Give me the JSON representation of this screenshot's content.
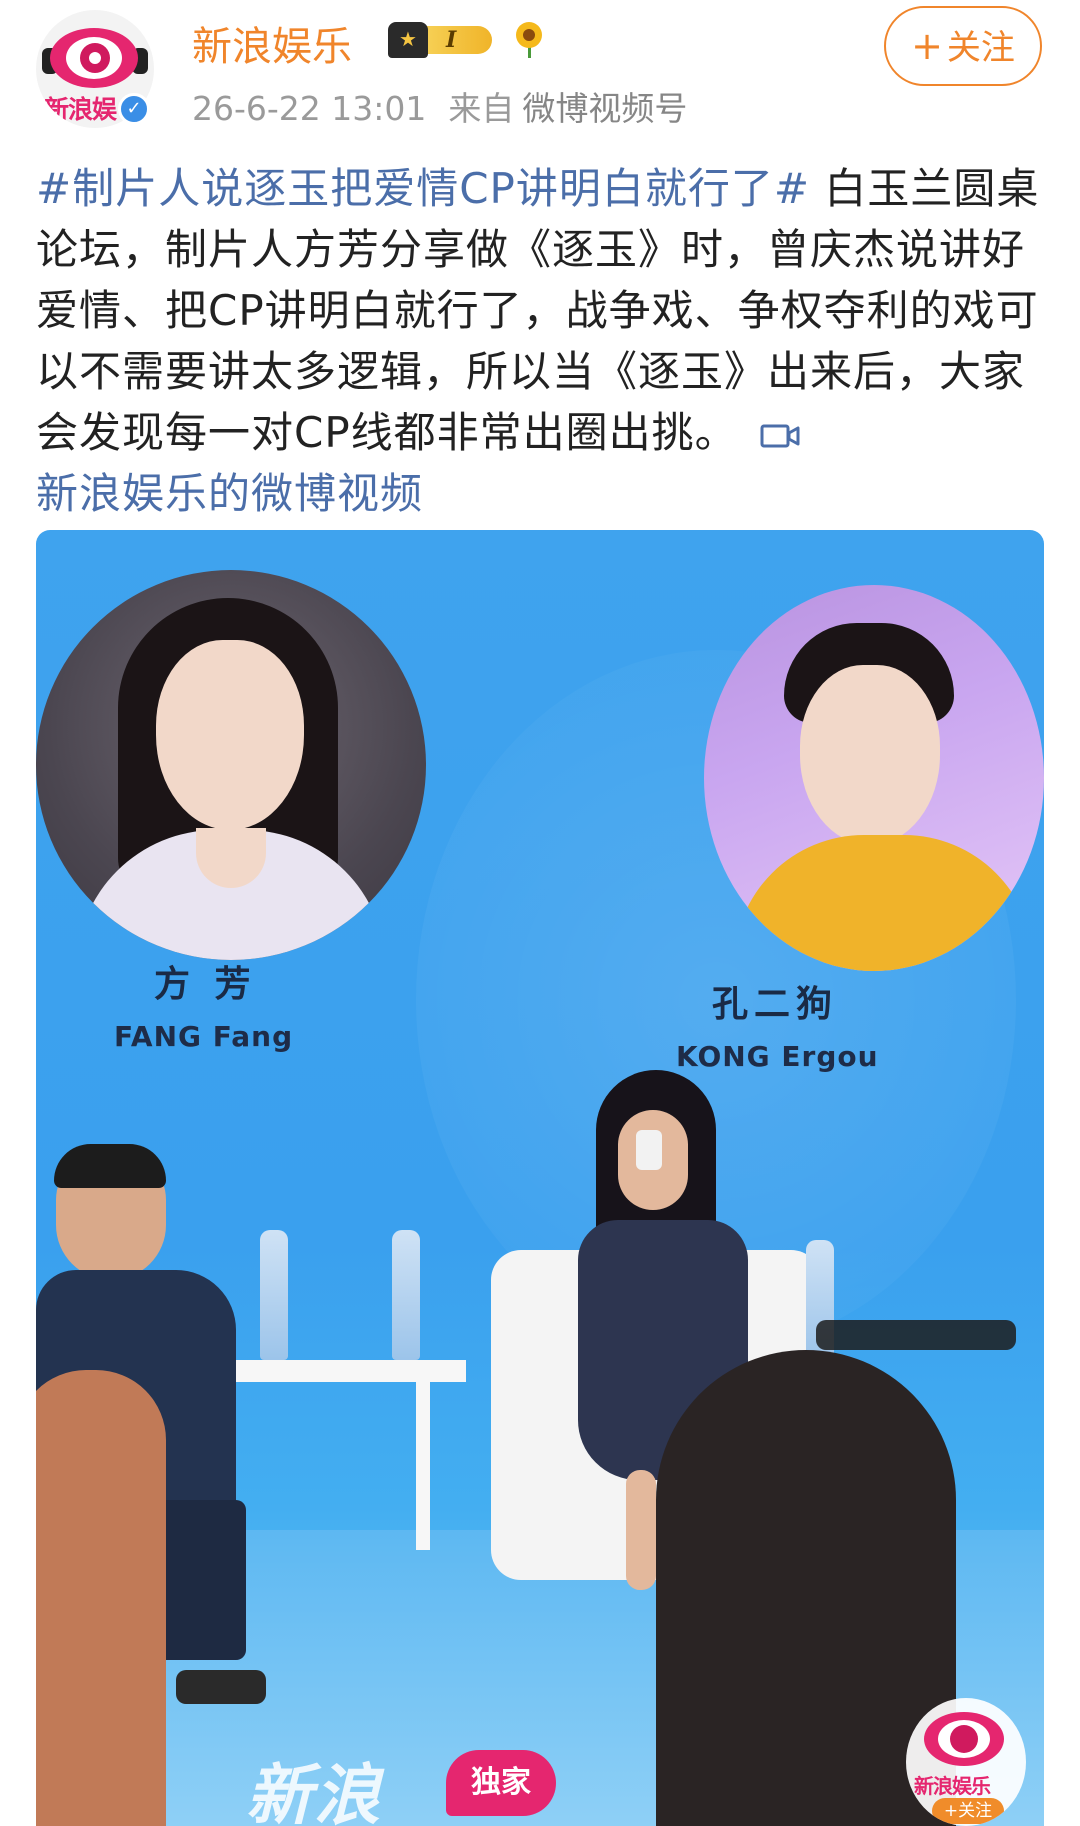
{
  "header": {
    "username": "新浪娱乐",
    "avatar_text": "新浪娱",
    "badge_level": "I",
    "timestamp": "26-6-22 13:01",
    "source_label": "来自",
    "source": "微博视频号",
    "follow_label": "关注",
    "follow_plus": "+"
  },
  "post": {
    "hashtag": "#制片人说逐玉把爱情CP讲明白就行了#",
    "body": " 白玉兰圆桌论坛，制片人方芳分享做《逐玉》时，曾庆杰说讲好爱情、把CP讲明白就行了，战争戏、争权夺利的戏可以不需要讲太多逻辑，所以当《逐玉》出来后，大家会发现每一对CP线都非常出圈出挑。",
    "video_link": "新浪娱乐的微博视频"
  },
  "video": {
    "left_name_cn": "方 芳",
    "left_name_en": "FANG Fang",
    "right_name_cn": "孔二狗",
    "right_name_en": "KONG Ergou",
    "watermark_text": "新浪",
    "watermark_badge": "独家",
    "logo_label": "新浪娱乐",
    "logo_follow": "+关注"
  },
  "colors": {
    "brand_orange": "#f0852b",
    "link_blue": "#4b6ea9",
    "brand_pink": "#e5266f",
    "stage_blue": "#3fa3ee"
  },
  "icons": [
    "verified-icon",
    "crown-badge-icon",
    "sunflower-icon",
    "video-camera-icon"
  ]
}
